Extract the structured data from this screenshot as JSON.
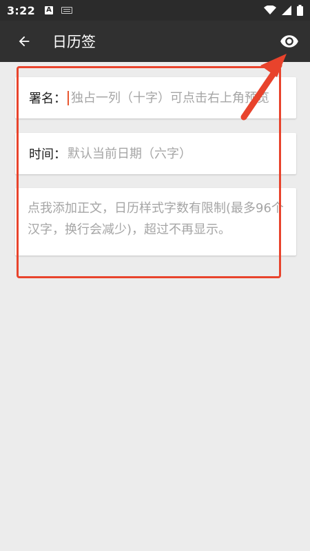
{
  "status_bar": {
    "time": "3:22",
    "a_badge": "A"
  },
  "app_bar": {
    "title": "日历签"
  },
  "form": {
    "signature": {
      "label": "署名：",
      "placeholder": "独占一列（十字）可点击右上角预览",
      "value": ""
    },
    "time": {
      "label": "时间：",
      "placeholder": "默认当前日期（六字）",
      "value": ""
    },
    "body": {
      "placeholder": "点我添加正文，日历样式字数有限制(最多96个汉字，换行会减少)，超过不再显示。",
      "value": ""
    }
  },
  "colors": {
    "app_bar": "#303030",
    "status_bar": "#2b2b2b",
    "background": "#ececec",
    "annotation": "#e8432c"
  },
  "icons": {
    "back": "arrow-back-icon",
    "preview": "eye-icon",
    "wifi": "wifi-icon",
    "signal": "cell-signal-icon",
    "battery": "battery-icon"
  }
}
